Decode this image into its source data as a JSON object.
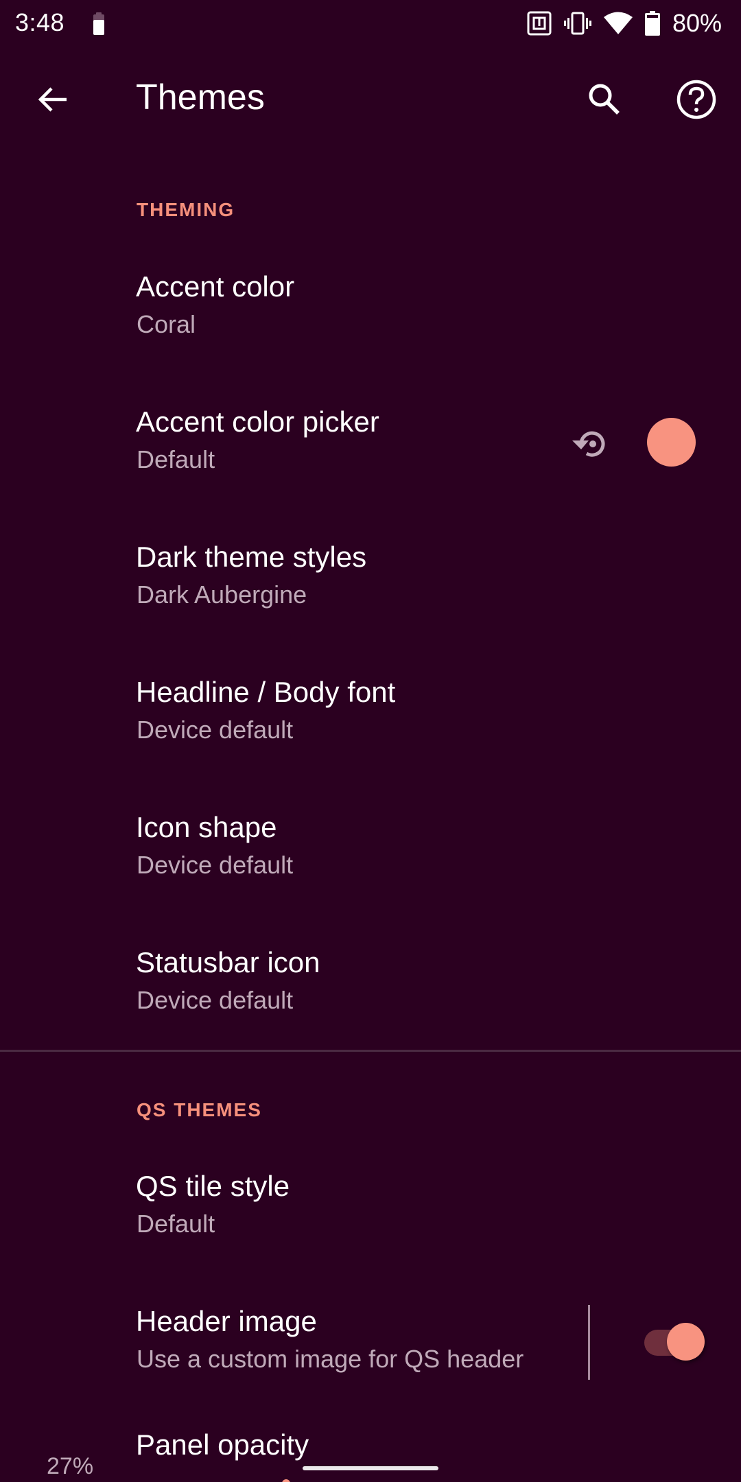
{
  "status_bar": {
    "time": "3:48",
    "battery_percent": "80%",
    "icons": [
      "battery-saver-icon",
      "nfc-icon",
      "vibrate-icon",
      "wifi-icon",
      "battery-icon"
    ]
  },
  "app_bar": {
    "title": "Themes",
    "back_icon": "arrow-back-icon",
    "search_icon": "search-icon",
    "help_icon": "help-circle-icon"
  },
  "colors": {
    "background": "#2b0020",
    "accent": "#f89380",
    "summary_text": "#c0aab9"
  },
  "sections": [
    {
      "header": "THEMING",
      "items": [
        {
          "title": "Accent color",
          "summary": "Coral"
        },
        {
          "title": "Accent color picker",
          "summary": "Default",
          "widget": {
            "reset_icon": "restore-icon",
            "swatch_color": "#f89380"
          }
        },
        {
          "title": "Dark theme styles",
          "summary": "Dark Aubergine"
        },
        {
          "title": "Headline / Body font",
          "summary": "Device default"
        },
        {
          "title": "Icon shape",
          "summary": "Device default"
        },
        {
          "title": "Statusbar icon",
          "summary": "Device default"
        }
      ]
    },
    {
      "header": "QS THEMES",
      "items": [
        {
          "title": "QS tile style",
          "summary": "Default"
        },
        {
          "title": "Header image",
          "summary": "Use a custom image for QS header",
          "toggle": {
            "checked": true
          }
        },
        {
          "title": "Panel opacity",
          "value": "27%"
        }
      ]
    }
  ]
}
